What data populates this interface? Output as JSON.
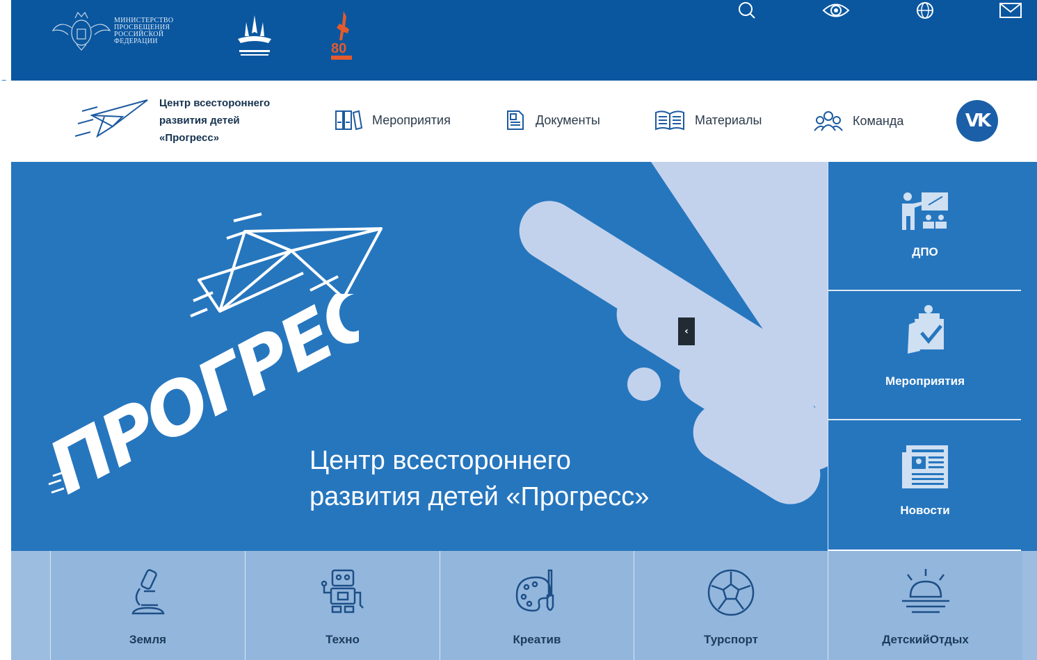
{
  "topbar": {
    "ministry_lines": "МИНИСТЕРСТВО\nПРОСВЕЩЕНИЯ\nРОССИЙСКОЙ\nФЕДЕРАЦИИ",
    "icons": [
      "search-icon",
      "eye-icon",
      "globe-icon",
      "mail-icon"
    ],
    "stray_link": "e"
  },
  "brand": {
    "line1": "Центр всестороннего",
    "line2": "развития детей",
    "line3": "«Прогресс»"
  },
  "nav": {
    "items": [
      {
        "label": "Мероприятия",
        "icon": "binders-icon"
      },
      {
        "label": "Документы",
        "icon": "document-icon"
      },
      {
        "label": "Материалы",
        "icon": "book-icon"
      },
      {
        "label": "Команда",
        "icon": "team-icon"
      }
    ],
    "vk_label": "VK"
  },
  "hero": {
    "wordmark": "ПРОГРЕСС",
    "title_line1": "Центр всестороннего",
    "title_line2": "развития детей «Прогресс»",
    "arrow": "‹"
  },
  "side_tiles": [
    {
      "label": "ДПО",
      "icon": "teacher-icon"
    },
    {
      "label": "Мероприятия",
      "icon": "clipboard-check-icon"
    },
    {
      "label": "Новости",
      "icon": "newspaper-icon"
    }
  ],
  "categories": [
    {
      "label": "Земля",
      "icon": "microscope-icon"
    },
    {
      "label": "Техно",
      "icon": "robot-icon"
    },
    {
      "label": "Креатив",
      "icon": "palette-icon"
    },
    {
      "label": "Турспорт",
      "icon": "soccer-ball-icon"
    },
    {
      "label": "ДетскийОтдых",
      "icon": "sunrise-icon"
    }
  ],
  "colors": {
    "topbar": "#0a57a0",
    "hero": "#2676be",
    "hero_shapes": "#c2d2ec",
    "category_bg": "#93b6dd",
    "dark_text": "#1d3b5a"
  }
}
